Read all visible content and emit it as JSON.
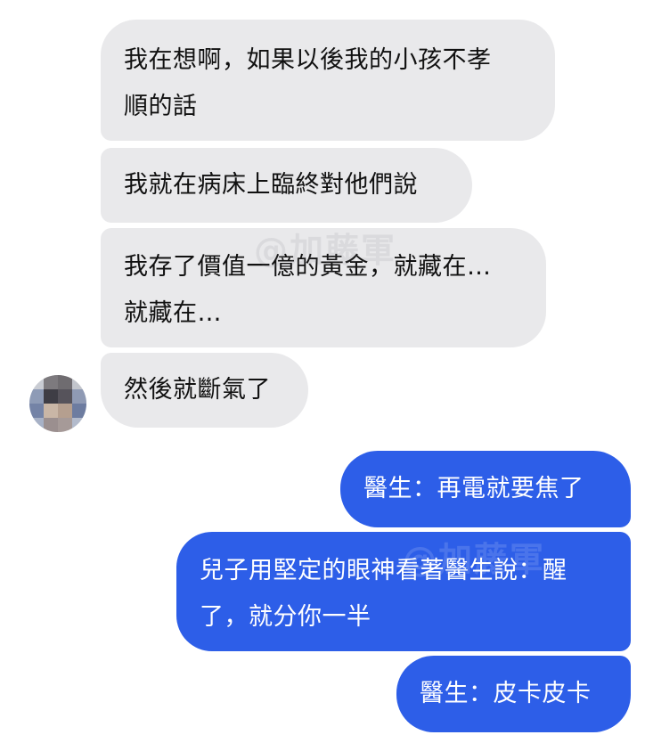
{
  "conversation": {
    "incoming": [
      {
        "text": "我在想啊，如果以後我的小孩不孝\n順的話"
      },
      {
        "text": "我就在病床上臨終對他們說"
      },
      {
        "text": "我存了價值一億的黃金，就藏在…\n就藏在…"
      },
      {
        "text": "然後就斷氣了"
      }
    ],
    "outgoing": [
      {
        "text": "醫生：再電就要焦了"
      },
      {
        "text": "兒子用堅定的眼神看著醫生說：醒\n了，就分你一半"
      },
      {
        "text": "醫生：皮卡皮卡"
      }
    ]
  },
  "watermark": "@加藤軍",
  "colors": {
    "incoming_bubble": "#e9e9eb",
    "outgoing_bubble": "#2d5ee8",
    "outgoing_text": "#ffffff"
  }
}
